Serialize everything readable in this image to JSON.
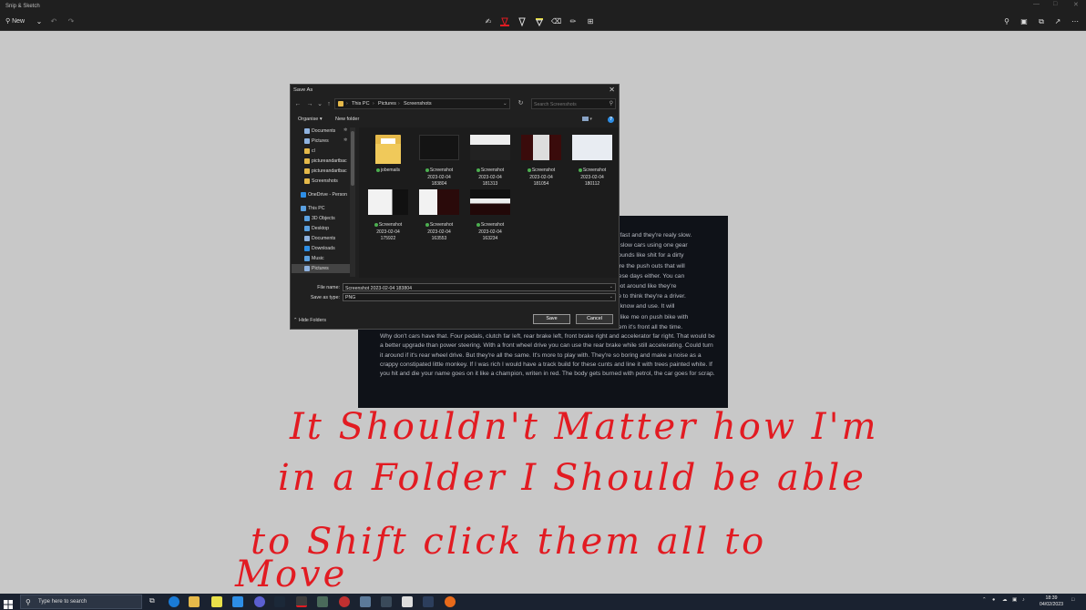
{
  "window": {
    "title": "Snip & Sketch"
  },
  "toolbar": {
    "new_label": "New"
  },
  "dialog": {
    "title": "Save As",
    "breadcrumb": [
      "This PC",
      "Pictures",
      "Screenshots"
    ],
    "search_placeholder": "Search Screenshots",
    "organise_label": "Organise",
    "new_folder_label": "New folder",
    "sidebar": [
      {
        "label": "Documents",
        "pinned": true,
        "color": "#8fb3e0"
      },
      {
        "label": "Pictures",
        "pinned": true,
        "color": "#8fb3e0"
      },
      {
        "label": "cl",
        "pinned": false,
        "color": "#e5b94a"
      },
      {
        "label": "pictureandartbac",
        "pinned": false,
        "color": "#e5b94a"
      },
      {
        "label": "pictureandartbac",
        "pinned": false,
        "color": "#e5b94a"
      },
      {
        "label": "Screenshots",
        "pinned": false,
        "color": "#e5b94a"
      },
      {
        "label": "OneDrive - Person",
        "pinned": false,
        "color": "#2d8ee6"
      },
      {
        "label": "This PC",
        "pinned": false,
        "color": "#5aa0e0"
      },
      {
        "label": "3D Objects",
        "pinned": false,
        "color": "#5aa0e0"
      },
      {
        "label": "Desktop",
        "pinned": false,
        "color": "#5aa0e0"
      },
      {
        "label": "Documents",
        "pinned": false,
        "color": "#8fb3e0"
      },
      {
        "label": "Downloads",
        "pinned": false,
        "color": "#2d8ee6"
      },
      {
        "label": "Music",
        "pinned": false,
        "color": "#5aa0e0"
      },
      {
        "label": "Pictures",
        "pinned": false,
        "color": "#8fb3e0"
      }
    ],
    "files": [
      {
        "name": "jobemails",
        "type": "folder"
      },
      {
        "name": "Screenshot\n2023-02-04\n183804",
        "type": "image"
      },
      {
        "name": "Screenshot\n2023-02-04\n181313",
        "type": "image"
      },
      {
        "name": "Screenshot\n2023-02-04\n181054",
        "type": "image"
      },
      {
        "name": "Screenshot\n2023-02-04\n180112",
        "type": "image"
      },
      {
        "name": "Screenshot\n2023-02-04\n175922",
        "type": "image"
      },
      {
        "name": "Screenshot\n2023-02-04\n163553",
        "type": "image"
      },
      {
        "name": "Screenshot\n2023-02-04\n163234",
        "type": "image"
      }
    ],
    "file_name_label": "File name:",
    "file_name_value": "Screenshot 2023-02-04 183804",
    "save_type_label": "Save as type:",
    "save_type_value": "PNG",
    "hide_folders_label": "Hide Folders",
    "save_label": "Save",
    "cancel_label": "Cancel"
  },
  "background_text": {
    "right_fragments": [
      "g fast and they're realy slow.",
      "n slow cars using one gear",
      "sounds like shit for a dirty",
      "y're the push outs that will",
      "hese days either. You can",
      "foot around like they're",
      "ke to think they're a driver.",
      "o know and use. It will",
      "e like me on push bike with",
      "hem it's front all the time."
    ],
    "paragraph": "Why don't cars have that. Four pedals, clutch far left, rear brake left, front brake right and accelerator far right. That would be a better upgrade than power steering. With a front wheel drive you can use the rear brake while still accelerating. Could turn it around if it's rear wheel drive. But they're all the same. It's more to play with. They're so boring and make a noise as a crappy constipated little monkey. If I was rich I would have a track build for these cunts and line it with trees painted white. If you hit and die your name goes on it like a champion, writen in red. The body gets burned with petrol, the car goes for scrap."
  },
  "handwriting": {
    "line1": "It Shouldn't Matter how I'm",
    "line2": "in a Folder I Should be able",
    "line3": "to Shift click them all to",
    "line4": "Move"
  },
  "taskbar": {
    "search_placeholder": "Type here to search",
    "time": "18:39",
    "date": "04/02/2023"
  },
  "colors": {
    "handwriting": "#e21b22",
    "accent": "#2d8ee6"
  }
}
